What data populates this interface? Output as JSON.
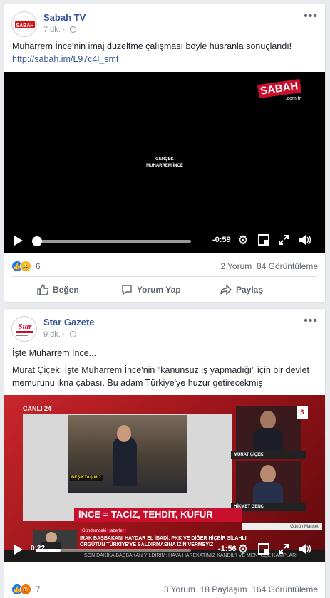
{
  "posts": [
    {
      "page_name": "Sabah TV",
      "time": "7 dk.",
      "text": "Muharrem İnce'nin imaj düzeltme çalışması böyle hüsranla sonuçlandı!",
      "link": "http://sabah.im/L97c4l_smf",
      "avatar_label": "SABAH",
      "video": {
        "watermark": "SABAH",
        "watermark_sub": ".com.tr",
        "overlay_line1": "GERÇEK",
        "overlay_line2": "MUHARREM İNCE",
        "time_remaining": "-0:59",
        "progress": 0.0
      },
      "reaction_count": "6",
      "comments": "2 Yorum",
      "views": "84 Görüntüleme",
      "actions": {
        "like": "Beğen",
        "comment": "Yorum Yap",
        "share": "Paylaş"
      }
    },
    {
      "page_name": "Star Gazete",
      "time": "9 dk.",
      "text1": "İşte Muharrem İnce...",
      "text2": "Murat Çiçek: İşte Muharrem İnce'nin \"kanunsuz iş yapmadığı\" için bir devlet",
      "text3": "memurunu ikna çabası. Bu adam Türkiye'ye huzur getirecekmiş",
      "avatar_label": "Star",
      "video": {
        "channel": "CANLI 24",
        "channel_number": "24",
        "caption_inset": "BEŞİKTAŞ MI?",
        "guest1": "MURAT ÇİÇEK",
        "guest2": "HİKMET GENÇ",
        "headline": "İNCE = TACİZ, TEHDİT, KÜFÜR",
        "segment": "Günün Manşeti",
        "ticker_label": "Gündemdeki Haberler",
        "ticker_line1": "IRAK BAŞBAKANI HAYDAR EL İBADİ: PKK VE DİĞER HİÇBİR SİLAHLI",
        "ticker_line2": "ÖRGÜTÜN TÜRKİYE'YE SALDIRMASINA İZİN VERMEYİZ",
        "bottom_ticker": "SON DAKİKA  BAŞBAKAN YILDIRIM: HAVA HAREKATIMIZ KANDİL'İ VE MENTEŞE KAMPLARI",
        "elapsed": "0:22",
        "time_remaining": "-1:56",
        "progress": 0.16
      },
      "reaction_count": "7",
      "comments": "3 Yorum",
      "shares": "18 Paylaşım",
      "views": "164 Görüntüleme"
    }
  ],
  "colors": {
    "link": "#385898",
    "like_blue": "#1877f2",
    "haha_yellow": "#f7b125",
    "angry": "#e9710f",
    "star_red": "#c8102e"
  }
}
